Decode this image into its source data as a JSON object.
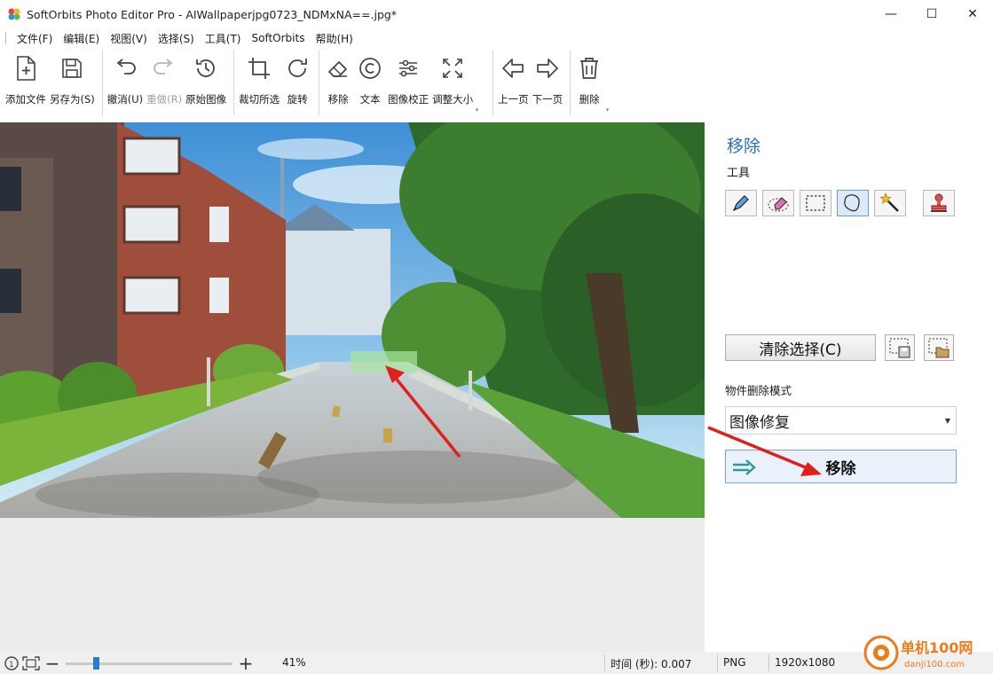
{
  "window": {
    "title": "SoftOrbits Photo Editor Pro - AIWallpaperjpg0723_NDMxNA==.jpg*",
    "controls": {
      "minimize": "—",
      "maximize": "☐",
      "close": "✕"
    }
  },
  "menu": [
    "文件(F)",
    "编辑(E)",
    "视图(V)",
    "选择(S)",
    "工具(T)",
    "SoftOrbits",
    "帮助(H)"
  ],
  "toolbar": {
    "groups": [
      [
        {
          "label": "添加文件",
          "icon": "add-file-icon"
        },
        {
          "label": "另存为(S)",
          "icon": "save-icon"
        }
      ],
      [
        {
          "label": "撤消(U)",
          "icon": "undo-icon"
        },
        {
          "label": "重做(R)",
          "icon": "redo-icon",
          "disabled": true
        },
        {
          "label": "原始图像",
          "icon": "history-icon"
        }
      ],
      [
        {
          "label": "裁切所选",
          "icon": "crop-icon"
        },
        {
          "label": "旋转",
          "icon": "rotate-icon"
        }
      ],
      [
        {
          "label": "移除",
          "icon": "eraser-icon"
        },
        {
          "label": "文本",
          "icon": "text-icon"
        },
        {
          "label": "图像校正",
          "icon": "adjust-icon"
        },
        {
          "label": "调整大小",
          "icon": "resize-icon"
        }
      ],
      [
        {
          "label": "上一页",
          "icon": "prev-page-icon"
        },
        {
          "label": "下一页",
          "icon": "next-page-icon"
        }
      ],
      [
        {
          "label": "删除",
          "icon": "delete-icon"
        }
      ]
    ]
  },
  "panel": {
    "title": "移除",
    "tools_label": "工具",
    "tools": [
      "marker-tool",
      "eraser-tool",
      "rect-select-tool",
      "lasso-tool",
      "magic-wand-tool",
      "stamp-tool"
    ],
    "active_tool": "lasso-tool",
    "clear_selection_label": "清除选择(C)",
    "mode_label": "物件删除模式",
    "mode_value": "图像修复",
    "remove_button_label": "移除"
  },
  "status": {
    "zoom_percent": "41%",
    "zoom_slider_fraction": 0.18,
    "time_label": "时间 (秒): 0.007",
    "format": "PNG",
    "dimensions": "1920x1080"
  },
  "watermark": {
    "text": "单机100网",
    "subtext": "danji100.com"
  },
  "colors": {
    "accent": "#2a6fb8",
    "annotation_arrow": "#e0201c",
    "remove_button_bg": "#eaf1fa"
  }
}
